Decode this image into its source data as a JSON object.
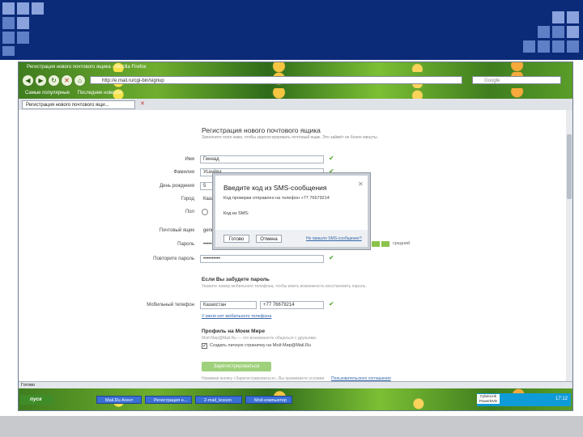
{
  "window": {
    "title": "Регистрация нового почтового ящика - Mozilla Firefox",
    "url": "http://e.mail.ru/cgi-bin/signup",
    "search_placeholder": "Google",
    "bookmarks": [
      "Самые популярные",
      "Последние новости"
    ],
    "tab_label": "Регистрация нового почтового ящи..."
  },
  "form": {
    "title": "Регистрация нового почтового ящика",
    "description": "Заполните поля ниже, чтобы зарегистрировать почтовый ящик. Это займёт не более минуты.",
    "rows": [
      {
        "label": "Имя",
        "value": "Геннад",
        "check": "✔"
      },
      {
        "label": "Фамилия",
        "value": "Усачёва",
        "check": "✔"
      },
      {
        "label": "День рождения",
        "value": "5",
        "check": ""
      },
      {
        "label": "Город",
        "value": "Казань",
        "check": ""
      },
      {
        "label": "Пол",
        "value": "",
        "check": ""
      },
      {
        "label": "Почтовый ящик",
        "value": "gennad",
        "check": ""
      },
      {
        "label": "Пароль",
        "value": "••••••••••",
        "check": ""
      },
      {
        "label": "Повторите пароль",
        "value": "••••••••••",
        "check": "✔"
      }
    ],
    "password_strength": "средний",
    "forgot_section_title": "Если Вы забудете пароль",
    "forgot_section_desc": "Укажите номер мобильного телефона, чтобы иметь возможность восстановить пароль.",
    "phone_label": "Мобильный телефон",
    "phone_country": "Казахстан",
    "phone_number": "+77 76679214",
    "no_phone_link": "У меня нет мобильного телефона",
    "profile_section_title": "Профиль на Моем Мире",
    "profile_section_desc": "Мой Мир@Mail.Ru — это возможность общаться с друзьями.",
    "profile_checkbox_label": "Создать личную страничку на Мой Мир@Mail.Ru",
    "submit_label": "Зарегистрироваться",
    "terms_text": "Нажимая кнопку «Зарегистрироваться», Вы принимаете условия",
    "terms_link": "Пользовательского соглашения"
  },
  "modal": {
    "title": "Введите код из SMS-сообщения",
    "close": "✕",
    "text": "Код проверки отправлен на телефон +77 76679214",
    "code_label": "Код из SMS:",
    "ok_label": "Готово",
    "cancel_label": "Отмена",
    "resend_link": "Не пришло SMS-сообщение?"
  },
  "status": {
    "text": "Готово"
  },
  "taskbar": {
    "start_label": "пуск",
    "tasks": [
      "Mail.Ru Агент",
      "Регистрация н...",
      "2-mail_lesson",
      "Мой компьютер"
    ],
    "tray_box": "CyberLink PowerDVD",
    "time": "17:12"
  }
}
